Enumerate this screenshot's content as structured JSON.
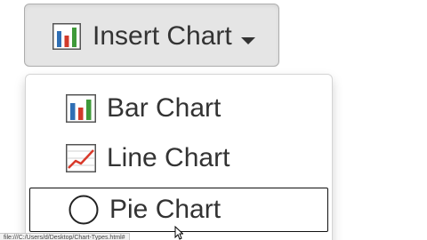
{
  "insert_button": {
    "label": "Insert Chart",
    "icon": "bar-chart-icon",
    "caret_icon": "caret-down-icon"
  },
  "menu": {
    "items": [
      {
        "label": "Bar Chart",
        "icon": "bar-chart-icon"
      },
      {
        "label": "Line Chart",
        "icon": "line-chart-icon"
      },
      {
        "label": "Pie Chart",
        "icon": "circle-icon",
        "state": "hovered"
      }
    ]
  },
  "status_bar": {
    "url": "file:///C:/Users/d/Desktop/Chart-Types.html#"
  },
  "colors": {
    "button_bg": "#e5e5e5",
    "button_border": "#adadad",
    "text": "#333333",
    "bar_blue": "#2f6fb5",
    "bar_red": "#d03a2a",
    "bar_green": "#3f9a3a",
    "line_red": "#d93a2b"
  }
}
